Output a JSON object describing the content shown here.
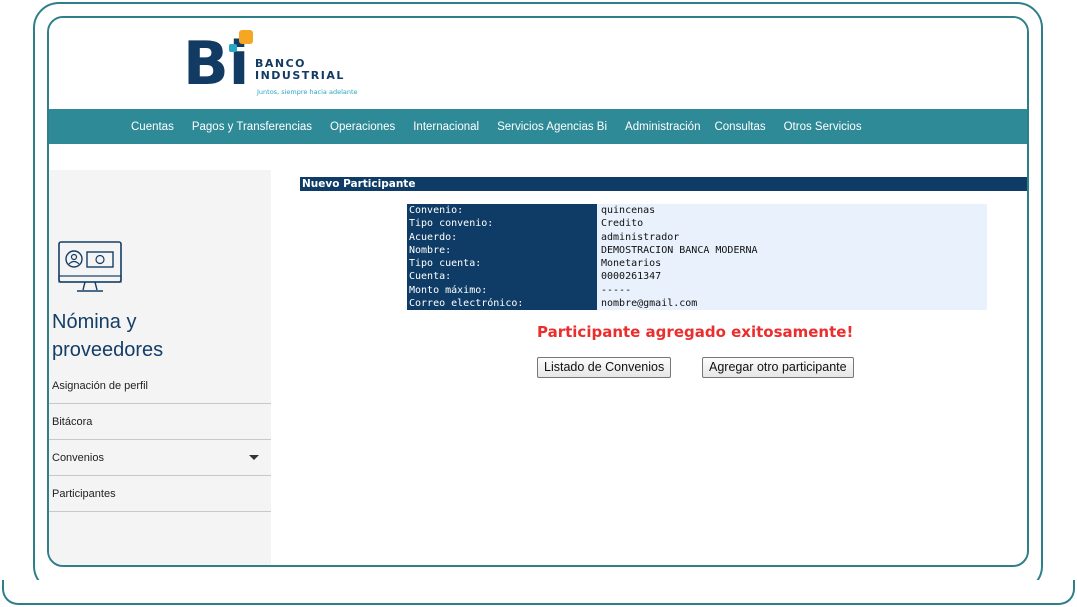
{
  "brand": {
    "letters": "Bi",
    "name_line1": "BANCO",
    "name_line2": "INDUSTRIAL",
    "tagline": "Juntos, siempre hacia adelante"
  },
  "nav": {
    "items": [
      "Cuentas",
      "Pagos y Transferencias",
      "Operaciones",
      "Internacional",
      "Servicios Agencias Bi",
      "Administración",
      "Consultas",
      "Otros Servicios"
    ]
  },
  "sidebar": {
    "icon": "payroll-monitor-icon",
    "title_line1": "Nómina y",
    "title_line2": "proveedores",
    "items": [
      {
        "label": "Asignación de perfil"
      },
      {
        "label": "Bitácora"
      },
      {
        "label": "Convenios",
        "icon": "caret-down-icon"
      },
      {
        "label": "Participantes"
      }
    ]
  },
  "main": {
    "section_title": "Nuevo Participante",
    "details": [
      {
        "label": "Convenio:",
        "value": "quincenas"
      },
      {
        "label": "Tipo convenio:",
        "value": "Credito"
      },
      {
        "label": "Acuerdo:",
        "value": "administrador"
      },
      {
        "label": "Nombre:",
        "value": "DEMOSTRACION BANCA MODERNA"
      },
      {
        "label": "Tipo cuenta:",
        "value": "Monetarios"
      },
      {
        "label": "Cuenta:",
        "value": "0000261347"
      },
      {
        "label": "Monto máximo:",
        "value": "-----"
      },
      {
        "label": "Correo electrónico:",
        "value": "nombre@gmail.com"
      }
    ],
    "success_message": "Participante agregado exitosamente!",
    "buttons": {
      "list_label": "Listado de Convenios",
      "add_label": "Agregar otro participante"
    }
  },
  "colors": {
    "frame": "#2f7f8a",
    "nav_bg": "#2f8a97",
    "dark_blue": "#0f3c66",
    "accent_orange": "#f5a623",
    "success_red": "#ea2e2e"
  }
}
